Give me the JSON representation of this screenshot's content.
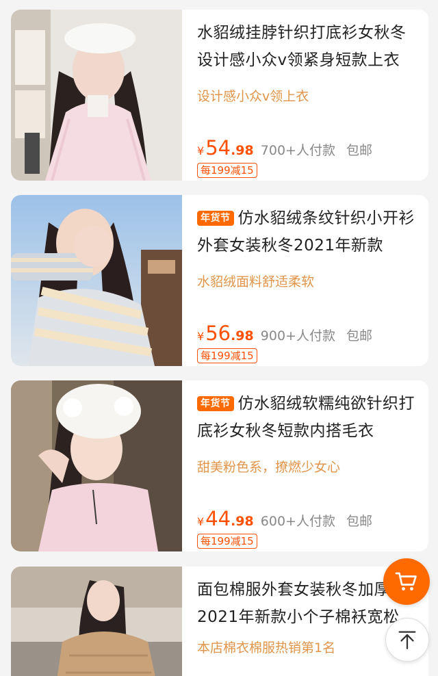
{
  "products": [
    {
      "title": "水貂绒挂脖针织打底衫女秋冬设计感小众v领紧身短款上衣",
      "tag": "",
      "subtitle": "设计感小众v领上衣",
      "currency": "¥",
      "price_int": "54",
      "price_dec": ".98",
      "sales": "700+人付款",
      "shipping": "包邮",
      "coupon": "每199减15",
      "image": "woman-white-beret-pink-knit-photo"
    },
    {
      "title": "仿水貂绒条纹针织小开衫外套女装秋冬2021年新款",
      "tag": "年货节",
      "subtitle": "水貂绒面料舒适柔软",
      "currency": "¥",
      "price_int": "56",
      "price_dec": ".98",
      "sales": "900+人付款",
      "shipping": "包邮",
      "coupon": "每199减15",
      "image": "woman-striped-cardigan-photo"
    },
    {
      "title": "仿水貂绒软糯纯欲针织打底衫女秋冬短款内搭毛衣",
      "tag": "年货节",
      "subtitle": "甜美粉色系，撩燃少女心",
      "currency": "¥",
      "price_int": "44",
      "price_dec": ".98",
      "sales": "600+人付款",
      "shipping": "包邮",
      "coupon": "每199减15",
      "image": "woman-fluffy-hat-pink-sweater-photo"
    },
    {
      "title": "面包棉服外套女装秋冬加厚2021年新款小个子棉袄宽松",
      "tag": "",
      "subtitle": "本店棉衣棉服热销第1名",
      "currency": "",
      "price_int": "",
      "price_dec": "",
      "sales": "",
      "shipping": "",
      "coupon": "",
      "image": "woman-beige-puffer-jacket-photo"
    }
  ],
  "floating": {
    "cart_icon": "cart-icon",
    "top_icon": "back-to-top-icon"
  },
  "colors": {
    "accent": "#ff5000",
    "tag_bg": "#ff6a00",
    "subtitle": "#e0954a"
  }
}
